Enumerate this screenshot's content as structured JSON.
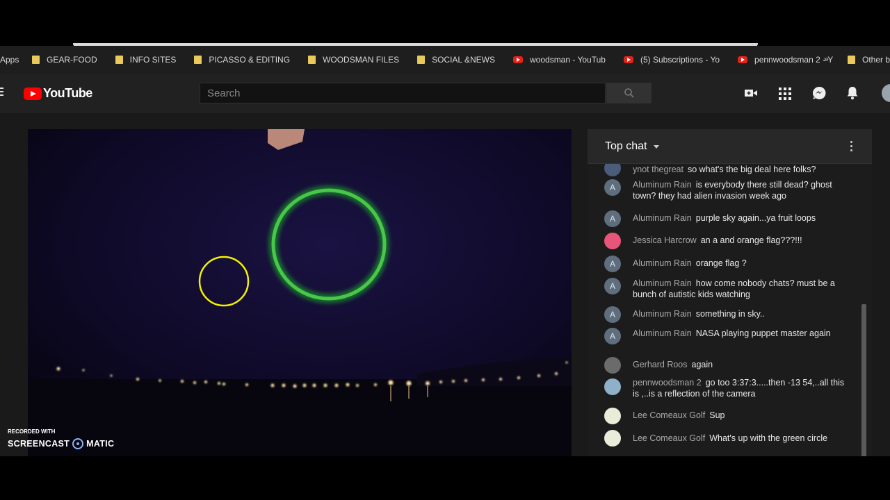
{
  "bookmarks": {
    "apps_label": "Apps",
    "items": [
      {
        "label": "GEAR-FOOD",
        "kind": "folder"
      },
      {
        "label": "INFO SITES",
        "kind": "folder"
      },
      {
        "label": "PICASSO & EDITING",
        "kind": "folder"
      },
      {
        "label": "WOODSMAN FILES",
        "kind": "folder"
      },
      {
        "label": "SOCIAL &NEWS",
        "kind": "folder"
      },
      {
        "label": "woodsman - YouTub",
        "kind": "youtube"
      },
      {
        "label": "(5) Subscriptions - Yo",
        "kind": "youtube"
      },
      {
        "label": "pennwoodsman 2 - Y",
        "kind": "youtube"
      }
    ],
    "overflow_label": "»",
    "other_label": "Other b"
  },
  "header": {
    "logo_text": "YouTube",
    "search_placeholder": "Search",
    "icons": [
      "create-video-icon",
      "apps-grid-icon",
      "messages-icon",
      "notifications-bell-icon",
      "account-avatar-icon"
    ]
  },
  "chat": {
    "title": "Top chat",
    "messages": [
      {
        "initial": "",
        "author": "ynot thegreat",
        "text": "so what's the big deal here folks?",
        "avatar_color": "#4b5b7a"
      },
      {
        "initial": "A",
        "author": "Aluminum Rain",
        "text": "is everybody there still dead? ghost town? they had alien invasion week ago",
        "avatar_color": "#5e6e7e"
      },
      {
        "initial": "A",
        "author": "Aluminum Rain",
        "text": "purple sky again...ya fruit loops",
        "avatar_color": "#5e6e7e"
      },
      {
        "initial": "",
        "author": "Jessica Harcrow",
        "text": "an a and orange flag???!!!",
        "avatar_color": "#e8557a"
      },
      {
        "initial": "A",
        "author": "Aluminum Rain",
        "text": "orange flag ?",
        "avatar_color": "#5e6e7e"
      },
      {
        "initial": "A",
        "author": "Aluminum Rain",
        "text": "how come nobody chats? must be a bunch of autistic kids watching",
        "avatar_color": "#5e6e7e"
      },
      {
        "initial": "A",
        "author": "Aluminum Rain",
        "text": "something in sky..",
        "avatar_color": "#5e6e7e"
      },
      {
        "initial": "A",
        "author": "Aluminum Rain",
        "text": "NASA playing puppet master again",
        "avatar_color": "#5e6e7e"
      },
      {
        "initial": "",
        "author": "Gerhard Roos",
        "text": "again",
        "avatar_color": "#6b6b6b"
      },
      {
        "initial": "",
        "author": "pennwoodsman 2",
        "text": "go too 3:37:3.....then -13 54,..all this is ,..is a reflection of the camera",
        "avatar_color": "#8fb0c9"
      },
      {
        "initial": "",
        "author": "Lee Comeaux Golf",
        "text": "Sup",
        "avatar_color": "#e9ecd8"
      },
      {
        "initial": "",
        "author": "Lee Comeaux Golf",
        "text": "What's up with the green circle",
        "avatar_color": "#e9ecd8"
      }
    ]
  },
  "watermark": {
    "line1": "RECORDED WITH",
    "word_left": "SCREENCAST",
    "word_right": "MATIC"
  }
}
